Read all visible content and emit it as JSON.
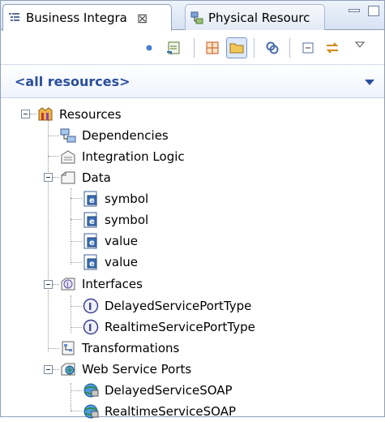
{
  "tabs": [
    {
      "label": "Business Integra",
      "close": "⊠",
      "icon": "business-integration-icon"
    },
    {
      "label": "Physical Resourc",
      "icon": "physical-resources-icon"
    }
  ],
  "filter": {
    "label": "<all resources>"
  },
  "tree": {
    "root": "Resources",
    "dependencies": "Dependencies",
    "integration_logic": "Integration Logic",
    "data": "Data",
    "data_items": [
      "symbol",
      "symbol",
      "value",
      "value"
    ],
    "interfaces": "Interfaces",
    "interface_items": [
      "DelayedServicePortType",
      "RealtimeServicePortType"
    ],
    "transformations": "Transformations",
    "web_service_ports": "Web Service Ports",
    "port_items": [
      "DelayedServiceSOAP",
      "RealtimeServiceSOAP"
    ]
  },
  "colors": {
    "accent": "#2a4e9d",
    "border": "#8f9ebb"
  }
}
